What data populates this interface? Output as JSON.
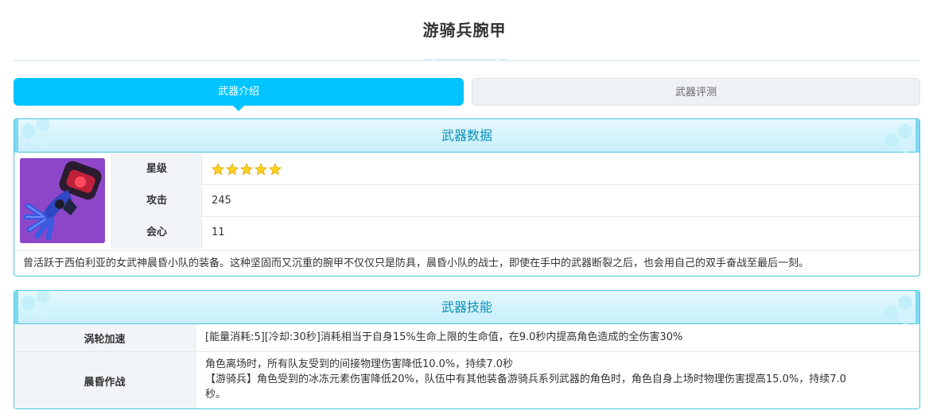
{
  "page": {
    "title": "游骑兵腕甲"
  },
  "tabs": [
    {
      "label": "武器介绍",
      "active": true
    },
    {
      "label": "武器评测",
      "active": false
    }
  ],
  "weapon_data": {
    "header": "武器数据",
    "image_icon": "gauntlet-icon",
    "stats": [
      {
        "label": "星级",
        "value": "",
        "stars": 5
      },
      {
        "label": "攻击",
        "value": "245"
      },
      {
        "label": "会心",
        "value": "11"
      }
    ],
    "description": "曾活跃于西伯利亚的女武神晨昏小队的装备。这种坚固而又沉重的腕甲不仅仅只是防具，晨昏小队的战士，即使在手中的武器断裂之后，也会用自己的双手奋战至最后一刻。"
  },
  "weapon_skills": {
    "header": "武器技能",
    "skills": [
      {
        "name": "涡轮加速",
        "lines": [
          "[能量消耗:5][冷却:30秒]消耗相当于自身15%生命上限的生命值，在9.0秒内提高角色造成的全伤害30%"
        ]
      },
      {
        "name": "晨昏作战",
        "lines": [
          "角色离场时，所有队友受到的间接物理伤害降低10.0%，持续7.0秒",
          "【游骑兵】角色受到的冰冻元素伤害降低20%，队伍中有其他装备游骑兵系列武器的角色时，角色自身上场时物理伤害提高15.0%，持续7.0",
          "秒。"
        ]
      }
    ]
  },
  "colors": {
    "accent": "#00c3ff",
    "panel_border": "#49c7e3",
    "header_text": "#0a8fb8",
    "star": "#ffd21f"
  }
}
